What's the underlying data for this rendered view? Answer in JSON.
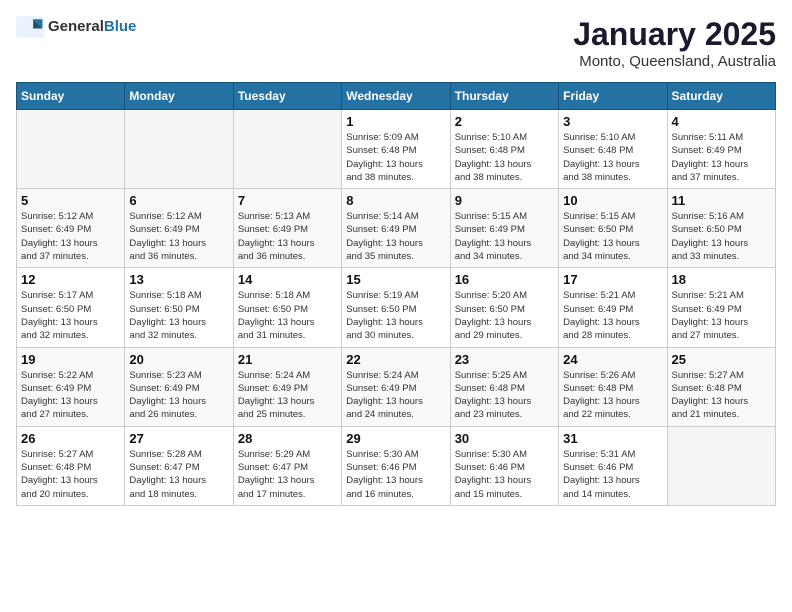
{
  "logo": {
    "general": "General",
    "blue": "Blue"
  },
  "header": {
    "month": "January 2025",
    "location": "Monto, Queensland, Australia"
  },
  "weekdays": [
    "Sunday",
    "Monday",
    "Tuesday",
    "Wednesday",
    "Thursday",
    "Friday",
    "Saturday"
  ],
  "weeks": [
    [
      {
        "day": "",
        "info": ""
      },
      {
        "day": "",
        "info": ""
      },
      {
        "day": "",
        "info": ""
      },
      {
        "day": "1",
        "info": "Sunrise: 5:09 AM\nSunset: 6:48 PM\nDaylight: 13 hours\nand 38 minutes."
      },
      {
        "day": "2",
        "info": "Sunrise: 5:10 AM\nSunset: 6:48 PM\nDaylight: 13 hours\nand 38 minutes."
      },
      {
        "day": "3",
        "info": "Sunrise: 5:10 AM\nSunset: 6:48 PM\nDaylight: 13 hours\nand 38 minutes."
      },
      {
        "day": "4",
        "info": "Sunrise: 5:11 AM\nSunset: 6:49 PM\nDaylight: 13 hours\nand 37 minutes."
      }
    ],
    [
      {
        "day": "5",
        "info": "Sunrise: 5:12 AM\nSunset: 6:49 PM\nDaylight: 13 hours\nand 37 minutes."
      },
      {
        "day": "6",
        "info": "Sunrise: 5:12 AM\nSunset: 6:49 PM\nDaylight: 13 hours\nand 36 minutes."
      },
      {
        "day": "7",
        "info": "Sunrise: 5:13 AM\nSunset: 6:49 PM\nDaylight: 13 hours\nand 36 minutes."
      },
      {
        "day": "8",
        "info": "Sunrise: 5:14 AM\nSunset: 6:49 PM\nDaylight: 13 hours\nand 35 minutes."
      },
      {
        "day": "9",
        "info": "Sunrise: 5:15 AM\nSunset: 6:49 PM\nDaylight: 13 hours\nand 34 minutes."
      },
      {
        "day": "10",
        "info": "Sunrise: 5:15 AM\nSunset: 6:50 PM\nDaylight: 13 hours\nand 34 minutes."
      },
      {
        "day": "11",
        "info": "Sunrise: 5:16 AM\nSunset: 6:50 PM\nDaylight: 13 hours\nand 33 minutes."
      }
    ],
    [
      {
        "day": "12",
        "info": "Sunrise: 5:17 AM\nSunset: 6:50 PM\nDaylight: 13 hours\nand 32 minutes."
      },
      {
        "day": "13",
        "info": "Sunrise: 5:18 AM\nSunset: 6:50 PM\nDaylight: 13 hours\nand 32 minutes."
      },
      {
        "day": "14",
        "info": "Sunrise: 5:18 AM\nSunset: 6:50 PM\nDaylight: 13 hours\nand 31 minutes."
      },
      {
        "day": "15",
        "info": "Sunrise: 5:19 AM\nSunset: 6:50 PM\nDaylight: 13 hours\nand 30 minutes."
      },
      {
        "day": "16",
        "info": "Sunrise: 5:20 AM\nSunset: 6:50 PM\nDaylight: 13 hours\nand 29 minutes."
      },
      {
        "day": "17",
        "info": "Sunrise: 5:21 AM\nSunset: 6:49 PM\nDaylight: 13 hours\nand 28 minutes."
      },
      {
        "day": "18",
        "info": "Sunrise: 5:21 AM\nSunset: 6:49 PM\nDaylight: 13 hours\nand 27 minutes."
      }
    ],
    [
      {
        "day": "19",
        "info": "Sunrise: 5:22 AM\nSunset: 6:49 PM\nDaylight: 13 hours\nand 27 minutes."
      },
      {
        "day": "20",
        "info": "Sunrise: 5:23 AM\nSunset: 6:49 PM\nDaylight: 13 hours\nand 26 minutes."
      },
      {
        "day": "21",
        "info": "Sunrise: 5:24 AM\nSunset: 6:49 PM\nDaylight: 13 hours\nand 25 minutes."
      },
      {
        "day": "22",
        "info": "Sunrise: 5:24 AM\nSunset: 6:49 PM\nDaylight: 13 hours\nand 24 minutes."
      },
      {
        "day": "23",
        "info": "Sunrise: 5:25 AM\nSunset: 6:48 PM\nDaylight: 13 hours\nand 23 minutes."
      },
      {
        "day": "24",
        "info": "Sunrise: 5:26 AM\nSunset: 6:48 PM\nDaylight: 13 hours\nand 22 minutes."
      },
      {
        "day": "25",
        "info": "Sunrise: 5:27 AM\nSunset: 6:48 PM\nDaylight: 13 hours\nand 21 minutes."
      }
    ],
    [
      {
        "day": "26",
        "info": "Sunrise: 5:27 AM\nSunset: 6:48 PM\nDaylight: 13 hours\nand 20 minutes."
      },
      {
        "day": "27",
        "info": "Sunrise: 5:28 AM\nSunset: 6:47 PM\nDaylight: 13 hours\nand 18 minutes."
      },
      {
        "day": "28",
        "info": "Sunrise: 5:29 AM\nSunset: 6:47 PM\nDaylight: 13 hours\nand 17 minutes."
      },
      {
        "day": "29",
        "info": "Sunrise: 5:30 AM\nSunset: 6:46 PM\nDaylight: 13 hours\nand 16 minutes."
      },
      {
        "day": "30",
        "info": "Sunrise: 5:30 AM\nSunset: 6:46 PM\nDaylight: 13 hours\nand 15 minutes."
      },
      {
        "day": "31",
        "info": "Sunrise: 5:31 AM\nSunset: 6:46 PM\nDaylight: 13 hours\nand 14 minutes."
      },
      {
        "day": "",
        "info": ""
      }
    ]
  ]
}
